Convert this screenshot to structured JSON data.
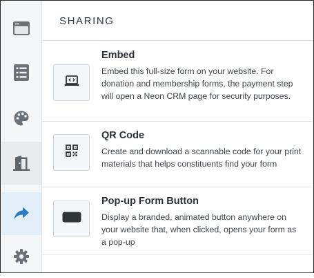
{
  "sidebar": {
    "items": [
      {
        "icon": "browser-window-icon"
      },
      {
        "icon": "list-icon"
      },
      {
        "icon": "palette-icon"
      },
      {
        "icon": "door-exit-icon"
      },
      {
        "icon": "share-arrow-icon"
      },
      {
        "icon": "gear-icon"
      }
    ],
    "active_item": "share-arrow-icon",
    "colors": {
      "background": "#f5f6f7",
      "active_blue": "#e2effa",
      "icon": "#6b7177",
      "active_icon": "#2b79c2"
    }
  },
  "header": {
    "title": "SHARING"
  },
  "options": [
    {
      "title": "Embed",
      "description": "Embed this full-size form on your website. For donation and membership forms, the payment step will open a Neon CRM page for security purposes.",
      "icon": "laptop-code-icon"
    },
    {
      "title": "QR Code",
      "description": "Create and download a scannable code for your print materials that helps constituents find your form",
      "icon": "qr-code-icon"
    },
    {
      "title": "Pop-up Form Button",
      "description": "Display a branded, animated button anywhere on your website that, when clicked, opens your form as a pop-up",
      "icon": "button-icon"
    }
  ]
}
